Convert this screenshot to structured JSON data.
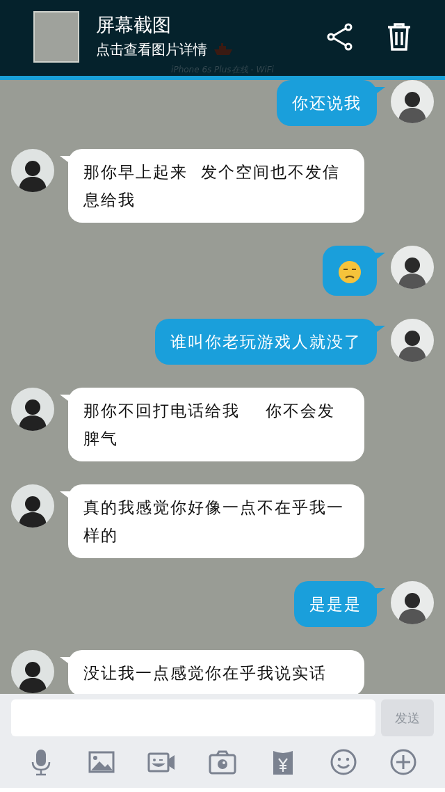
{
  "notification": {
    "title": "屏幕截图",
    "subtitle": "点击查看图片详情",
    "behind_text": "iPhone 6s Plus在线 - WiFi"
  },
  "messages": [
    {
      "kind": "sent",
      "text": "你还说我"
    },
    {
      "kind": "received",
      "text": "那你早上起来  发个空间也不发信息给我"
    },
    {
      "kind": "emoji"
    },
    {
      "kind": "sent",
      "text": "谁叫你老玩游戏人就没了"
    },
    {
      "kind": "received",
      "text": "那你不回打电话给我    你不会发脾气"
    },
    {
      "kind": "received",
      "text": "真的我感觉你好像一点不在乎我一样的"
    },
    {
      "kind": "sent",
      "text": "是是是"
    },
    {
      "kind": "received",
      "text": "没让我一点感觉你在乎我说实话"
    }
  ],
  "composer": {
    "send_label": "发送",
    "send_disabled": true
  }
}
